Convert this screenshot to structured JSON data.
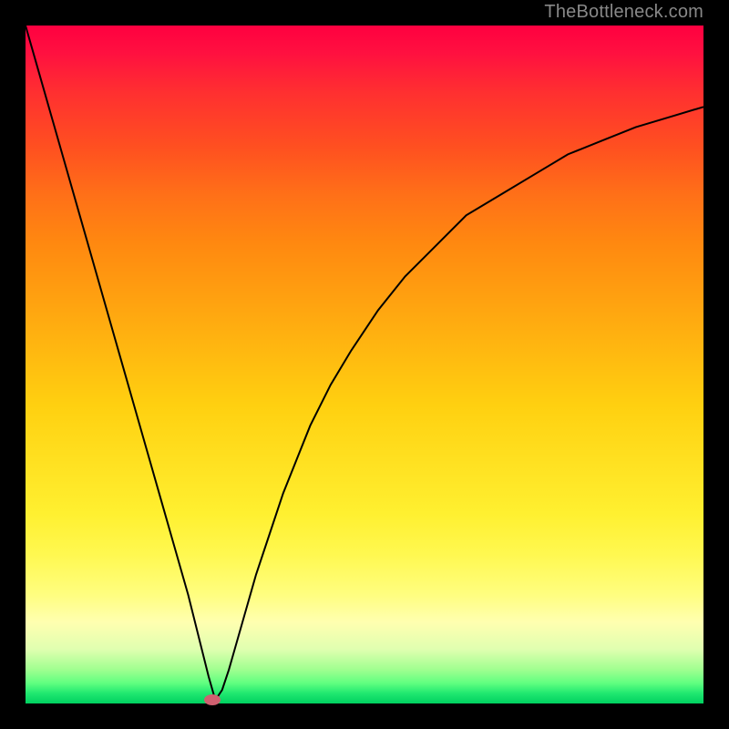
{
  "watermark": "TheBottleneck.com",
  "chart_data": {
    "type": "line",
    "title": "",
    "xlabel": "",
    "ylabel": "",
    "xlim": [
      0,
      100
    ],
    "ylim": [
      0,
      100
    ],
    "background_gradient": {
      "top": "#ff0040",
      "bottom": "#00d060",
      "type": "vertical-spectral"
    },
    "series": [
      {
        "name": "bottleneck-curve",
        "x": [
          0,
          2,
          4,
          6,
          8,
          10,
          12,
          14,
          16,
          18,
          20,
          22,
          24,
          26,
          27,
          28,
          29,
          30,
          32,
          34,
          36,
          38,
          40,
          42,
          45,
          48,
          52,
          56,
          60,
          65,
          70,
          75,
          80,
          85,
          90,
          95,
          100
        ],
        "y": [
          100,
          93,
          86,
          79,
          72,
          65,
          58,
          51,
          44,
          37,
          30,
          23,
          16,
          8,
          4,
          0.5,
          2,
          5,
          12,
          19,
          25,
          31,
          36,
          41,
          47,
          52,
          58,
          63,
          67,
          72,
          75,
          78,
          81,
          83,
          85,
          86.5,
          88
        ],
        "color": "#000000",
        "stroke_width": 2
      }
    ],
    "marker": {
      "x": 27.5,
      "y": 0.5,
      "color": "#d06070"
    }
  }
}
